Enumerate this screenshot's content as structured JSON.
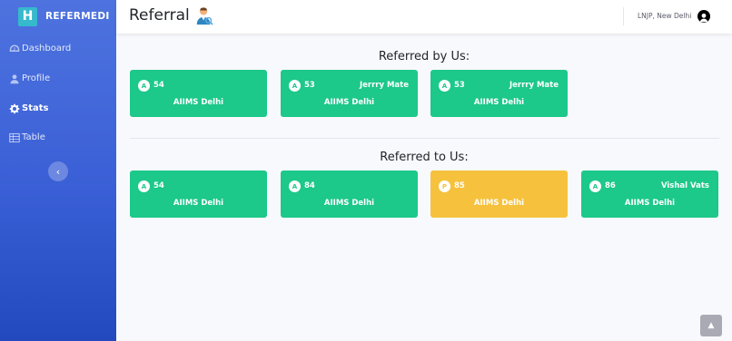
{
  "brand": {
    "logo_letter": "H",
    "name": "REFERMEDI"
  },
  "sidebar": {
    "items": [
      {
        "label": "Dashboard",
        "icon": "dashboard-icon",
        "active": false
      },
      {
        "label": "Profile",
        "icon": "user-icon",
        "active": false
      },
      {
        "label": "Stats",
        "icon": "gear-icon",
        "active": true
      },
      {
        "label": "Table",
        "icon": "table-icon",
        "active": false
      }
    ],
    "toggle_glyph": "‹"
  },
  "header": {
    "title": "Referral",
    "user_name": "LNJP, New Delhi"
  },
  "referred_by": {
    "title": "Referred by Us:",
    "cards": [
      {
        "badge": "A",
        "number": "54",
        "name": "",
        "hospital": "AIIMS Delhi",
        "color": "#1cc88a"
      },
      {
        "badge": "A",
        "number": "53",
        "name": "Jerrry Mate",
        "hospital": "AIIMS Delhi",
        "color": "#1cc88a"
      },
      {
        "badge": "A",
        "number": "53",
        "name": "Jerrry Mate",
        "hospital": "AIIMS Delhi",
        "color": "#1cc88a"
      }
    ]
  },
  "referred_to": {
    "title": "Referred to Us:",
    "cards": [
      {
        "badge": "A",
        "number": "54",
        "name": "",
        "hospital": "AIIMS Delhi",
        "color": "#1cc88a"
      },
      {
        "badge": "A",
        "number": "84",
        "name": "",
        "hospital": "AIIMS Delhi",
        "color": "#1cc88a"
      },
      {
        "badge": "P",
        "number": "85",
        "name": "",
        "hospital": "AIIMS Delhi",
        "color": "#f6c23e"
      },
      {
        "badge": "A",
        "number": "86",
        "name": "Vishal Vats",
        "hospital": "AIIMS Delhi",
        "color": "#1cc88a"
      }
    ]
  },
  "scroll_top_glyph": "▲",
  "colors": {
    "primary": "#4e73df",
    "success": "#1cc88a",
    "warning": "#f6c23e"
  }
}
